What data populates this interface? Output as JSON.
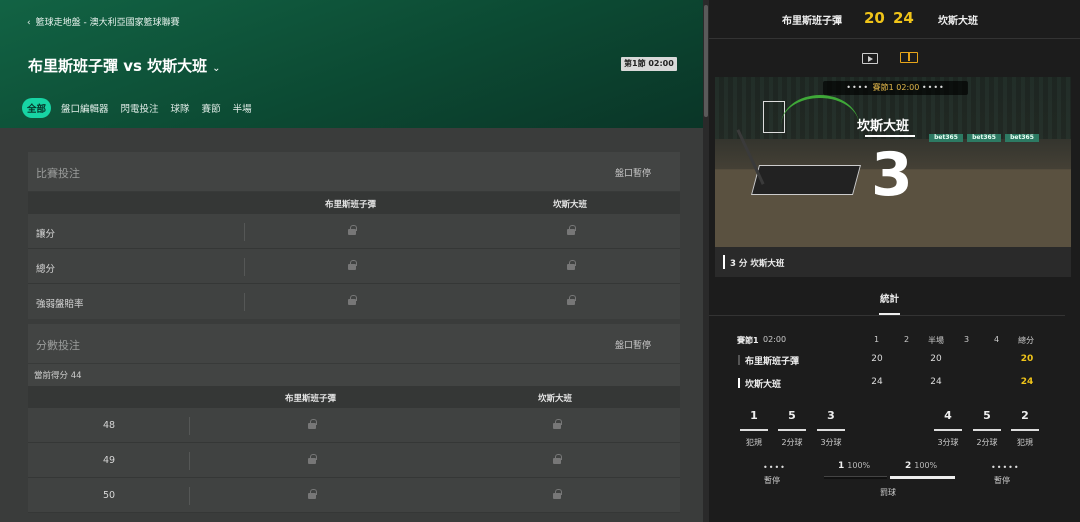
{
  "header": {
    "breadcrumb": "籃球走地盤 - 澳大利亞國家籃球聯賽",
    "match_title": "布里斯班子彈 vs 坎斯大班",
    "period_badge": "第1節 02:00",
    "tabs": [
      "全部",
      "盤口編輯器",
      "閃電投注",
      "球隊",
      "賽節",
      "半場"
    ],
    "active_tab": "全部"
  },
  "match_bets": {
    "title": "比賽投注",
    "status": "盤口暫停",
    "home_col": "布里斯班子彈",
    "away_col": "坎斯大班",
    "rows": [
      "讓分",
      "總分",
      "強弱盤賠率"
    ]
  },
  "points_bets": {
    "title": "分數投注",
    "status": "盤口暫停",
    "current_score": "當前得分 44",
    "home_col": "布里斯班子彈",
    "away_col": "坎斯大班",
    "rows": [
      "48",
      "49",
      "50"
    ]
  },
  "scoreboard": {
    "home": "布里斯班子彈",
    "away": "坎斯大班",
    "home_score": "20",
    "away_score": "24",
    "accent_color": "#f0c419"
  },
  "animation": {
    "topbar_period": "賽節1",
    "topbar_clock": "02:00",
    "team": "坎斯大班",
    "points": "3",
    "ad_text": "bet365",
    "event_text": "3 分 坎斯大班"
  },
  "stats": {
    "tab": "統計",
    "period_label": "賽節1",
    "clock": "02:00",
    "columns": [
      "1",
      "2",
      "半場",
      "3",
      "4",
      "總分"
    ],
    "teams": [
      {
        "name": "布里斯班子彈",
        "q1": "20",
        "half": "20",
        "total": "20",
        "marker_color": "#111111"
      },
      {
        "name": "坎斯大班",
        "q1": "24",
        "half": "24",
        "total": "24",
        "marker_color": "#ffffff"
      }
    ],
    "home_counts": [
      {
        "value": "1",
        "label": "犯規"
      },
      {
        "value": "5",
        "label": "2分球"
      },
      {
        "value": "3",
        "label": "3分球"
      }
    ],
    "away_counts": [
      {
        "value": "4",
        "label": "3分球"
      },
      {
        "value": "5",
        "label": "2分球"
      },
      {
        "value": "2",
        "label": "犯規"
      }
    ],
    "timeouts_label": "暫停",
    "home_timeouts": "••••",
    "away_timeouts": "•••••",
    "free_throws": {
      "label": "罰球",
      "home": "1",
      "home_pct": "100%",
      "away": "2",
      "away_pct": "100%"
    }
  }
}
